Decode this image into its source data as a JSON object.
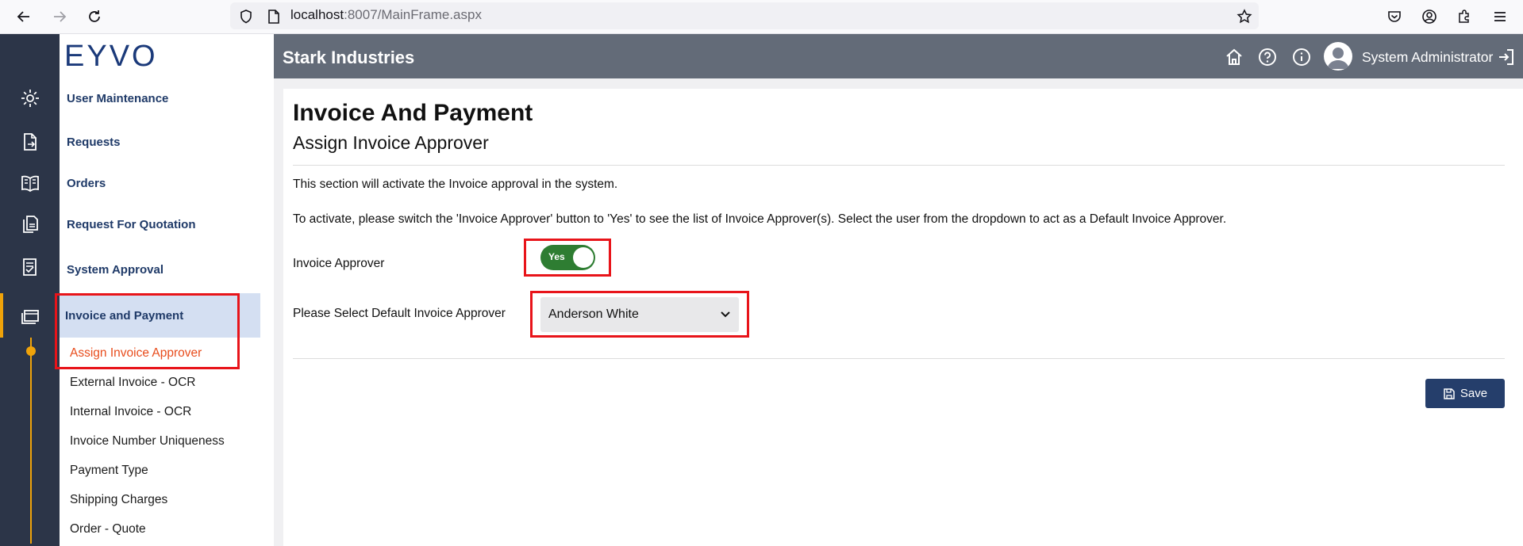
{
  "browser": {
    "url_host": "localhost",
    "url_rest": ":8007/MainFrame.aspx"
  },
  "logo": {
    "text": "EYVO"
  },
  "header": {
    "company": "Stark Industries",
    "user": "System Administrator"
  },
  "menu": {
    "items": [
      {
        "label": "User Maintenance"
      },
      {
        "label": "Requests"
      },
      {
        "label": "Orders"
      },
      {
        "label": "Request For Quotation"
      },
      {
        "label": "System Approval"
      },
      {
        "label": "Invoice and Payment"
      }
    ],
    "subitems": [
      {
        "label": "Assign Invoice Approver"
      },
      {
        "label": "External Invoice - OCR"
      },
      {
        "label": "Internal Invoice - OCR"
      },
      {
        "label": "Invoice Number Uniqueness"
      },
      {
        "label": "Payment Type"
      },
      {
        "label": "Shipping Charges"
      },
      {
        "label": "Order - Quote"
      }
    ]
  },
  "page": {
    "title": "Invoice And Payment",
    "subtitle": "Assign Invoice Approver",
    "para1": "This section will activate the Invoice approval in the system.",
    "para2": "To activate, please switch the 'Invoice Approver' button to 'Yes' to see the list of Invoice Approver(s). Select the user from the dropdown to act as a Default Invoice Approver.",
    "approver_label": "Invoice Approver",
    "toggle_value": "Yes",
    "default_label": "Please Select Default Invoice Approver",
    "default_value": "Anderson White",
    "save_label": "Save"
  },
  "colors": {
    "accent": "#f0a30a",
    "toggle_on": "#2e7d32",
    "save_button": "#253e6b",
    "highlight": "#e8141a",
    "active_subitem": "#e84c1c"
  }
}
